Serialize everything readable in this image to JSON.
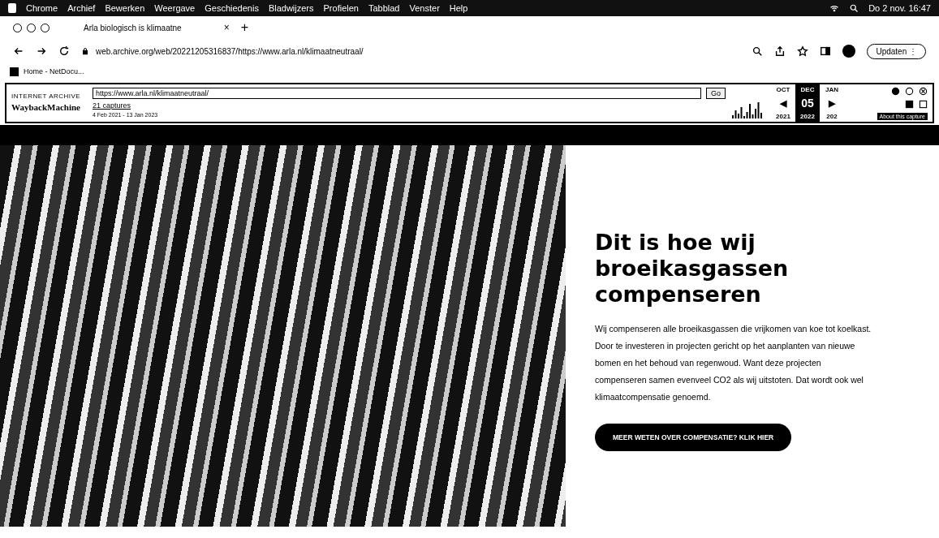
{
  "menu_bar": {
    "app_menus": [
      "Chrome",
      "Archief",
      "Bewerken",
      "Weergave",
      "Geschiedenis",
      "Bladwijzers",
      "Profielen",
      "Tabblad",
      "Venster",
      "Help"
    ],
    "clock": "Do 2 nov. 16:47"
  },
  "browser": {
    "tab": {
      "title": "Arla biologisch is klimaatne",
      "close": "×",
      "new_tab": "+"
    },
    "address": "web.archive.org/web/20221205316837/https://www.arla.nl/klimaatneutraal/",
    "update_button": "Updaten",
    "menu_glyph": "⋮",
    "bookmark": "Home - NetDocu..."
  },
  "wayback": {
    "brand": "INTERNET ARCHIVE",
    "logo": "WaybackMachine",
    "url": "https://www.arla.nl/klimaatneutraal/",
    "go": "Go",
    "captures": "21 captures",
    "range": "4 Feb 2021 - 13 Jan 2023",
    "months": [
      {
        "month": "OCT",
        "year": "2021",
        "selected": false
      },
      {
        "month": "DEC",
        "year": "2022",
        "selected": true
      },
      {
        "month": "JAN",
        "year": "202",
        "selected": false
      }
    ],
    "day": "05",
    "prev": "◀",
    "next": "▶",
    "about": "About this capture"
  },
  "hero": {
    "heading": "Dit is hoe wij broeikasgassen compenseren",
    "body": "Wij compenseren alle broeikasgassen die vrijkomen van koe tot koelkast. Door te investeren in projecten gericht op het aanplanten van nieuwe bomen en het behoud van regenwoud. Want deze projecten compenseren samen evenveel CO2 als wij uitstoten. Dat wordt ook wel klimaatcompensatie genoemd.",
    "cta": "MEER WETEN OVER COMPENSATIE? KLIK HIER"
  }
}
